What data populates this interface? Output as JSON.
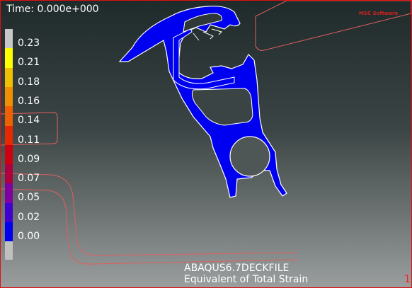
{
  "viewport": {
    "time_label": "Time:",
    "time_value": "0.000e+000",
    "time_cut": "",
    "logo": "MSC Software"
  },
  "legend": {
    "entries": [
      {
        "label": "0.23",
        "color": "#c8c8c8"
      },
      {
        "label": "0.21",
        "color": "#ffff00"
      },
      {
        "label": "0.18",
        "color": "#f0c000"
      },
      {
        "label": "0.16",
        "color": "#f09000"
      },
      {
        "label": "0.14",
        "color": "#f06000"
      },
      {
        "label": "0.11",
        "color": "#e82800"
      },
      {
        "label": "0.09",
        "color": "#d00010"
      },
      {
        "label": "0.07",
        "color": "#b00040"
      },
      {
        "label": "0.05",
        "color": "#8000a0"
      },
      {
        "label": "0.02",
        "color": "#4000d0"
      },
      {
        "label": "0.00",
        "color": "#0000f0"
      }
    ],
    "bottom_color": "#c0c0c0"
  },
  "colors": {
    "part": "#0000f0",
    "outline": "#ffffff",
    "tool_outline": "#e06060"
  },
  "captions": {
    "line1": "ABAQUS6.7DECKFILE",
    "line2": "Equivalent of Total Strain",
    "frame": "1"
  }
}
